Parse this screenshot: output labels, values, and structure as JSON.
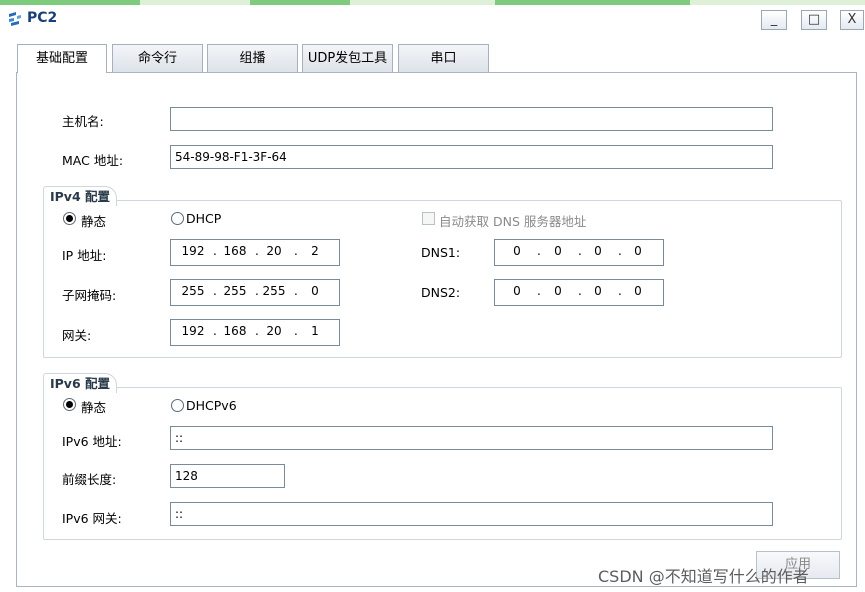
{
  "window": {
    "title": "PC2",
    "minimize": "_",
    "maximize": "□",
    "close": "X"
  },
  "tabs": [
    {
      "label": "基础配置",
      "active": true
    },
    {
      "label": "命令行",
      "active": false
    },
    {
      "label": "组播",
      "active": false
    },
    {
      "label": "UDP发包工具",
      "active": false
    },
    {
      "label": "串口",
      "active": false
    }
  ],
  "basic": {
    "hostname_label": "主机名:",
    "hostname_value": "",
    "mac_label": "MAC 地址:",
    "mac_value": "54-89-98-F1-3F-64"
  },
  "ipv4": {
    "title": "IPv4 配置",
    "static_label": "静态",
    "dhcp_label": "DHCP",
    "selected_mode": "静态",
    "auto_dns_label": "自动获取 DNS 服务器地址",
    "auto_dns_checked": false,
    "ip_label": "IP 地址:",
    "ip": [
      "192",
      "168",
      "20",
      "2"
    ],
    "mask_label": "子网掩码:",
    "mask": [
      "255",
      "255",
      "255",
      "0"
    ],
    "gateway_label": "网关:",
    "gateway": [
      "192",
      "168",
      "20",
      "1"
    ],
    "dns1_label": "DNS1:",
    "dns1": [
      "0",
      "0",
      "0",
      "0"
    ],
    "dns2_label": "DNS2:",
    "dns2": [
      "0",
      "0",
      "0",
      "0"
    ]
  },
  "ipv6": {
    "title": "IPv6 配置",
    "static_label": "静态",
    "dhcp_label": "DHCPv6",
    "selected_mode": "静态",
    "address_label": "IPv6 地址:",
    "address_value": "::",
    "prefix_label": "前缀长度:",
    "prefix_value": "128",
    "gateway_label": "IPv6 网关:",
    "gateway_value": "::"
  },
  "apply_label": "应用",
  "watermark": "CSDN @不知道写什么的作者"
}
